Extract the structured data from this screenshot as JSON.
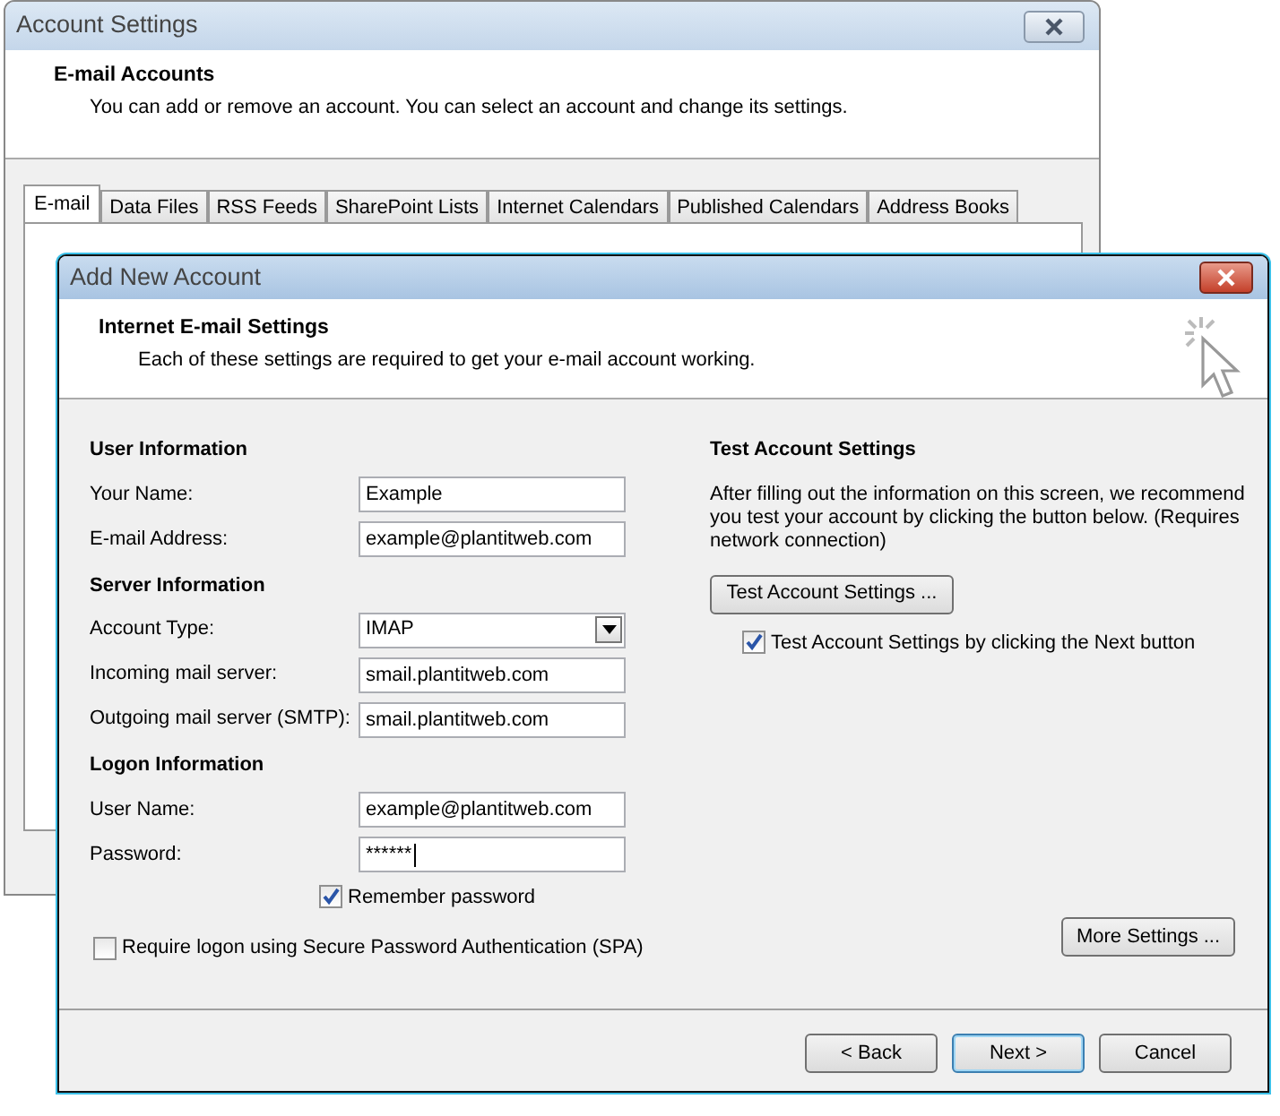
{
  "background_window": {
    "title": "Account Settings",
    "heading": "E-mail Accounts",
    "description": "You can add or remove an account. You can select an account and change its settings.",
    "tabs": [
      {
        "label": "E-mail",
        "selected": true
      },
      {
        "label": "Data Files",
        "selected": false
      },
      {
        "label": "RSS Feeds",
        "selected": false
      },
      {
        "label": "SharePoint Lists",
        "selected": false
      },
      {
        "label": "Internet Calendars",
        "selected": false
      },
      {
        "label": "Published Calendars",
        "selected": false
      },
      {
        "label": "Address Books",
        "selected": false
      }
    ]
  },
  "dialog": {
    "title": "Add New Account",
    "heading": "Internet E-mail Settings",
    "description": "Each of these settings are required to get your e-mail account working.",
    "sections": [
      {
        "title": "User Information",
        "fields": [
          {
            "label": "Your Name:",
            "value": "Example",
            "kind": "text"
          },
          {
            "label": "E-mail Address:",
            "value": "example@plantitweb.com",
            "kind": "text"
          }
        ]
      },
      {
        "title": "Server Information",
        "fields": [
          {
            "label": "Account Type:",
            "value": "IMAP",
            "kind": "select"
          },
          {
            "label": "Incoming mail server:",
            "value": "smail.plantitweb.com",
            "kind": "text"
          },
          {
            "label": "Outgoing mail server (SMTP):",
            "value": "smail.plantitweb.com",
            "kind": "text"
          }
        ]
      },
      {
        "title": "Logon Information",
        "fields": [
          {
            "label": "User Name:",
            "value": "example@plantitweb.com",
            "kind": "text"
          },
          {
            "label": "Password:",
            "value": "******",
            "kind": "password"
          }
        ]
      }
    ],
    "remember_password": {
      "label": "Remember password",
      "checked": true
    },
    "spa": {
      "label": "Require logon using Secure Password Authentication (SPA)",
      "checked": false
    },
    "test": {
      "title": "Test Account Settings",
      "description": "After filling out the information on this screen, we recommend you test your account by clicking the button below. (Requires network connection)",
      "button": "Test Account Settings ...",
      "auto_test": {
        "label": "Test Account Settings by clicking the Next button",
        "checked": true
      }
    },
    "more_settings": "More Settings ...",
    "buttons": [
      {
        "label": "< Back",
        "default": false
      },
      {
        "label": "Next >",
        "default": true
      },
      {
        "label": "Cancel",
        "default": false
      }
    ]
  }
}
